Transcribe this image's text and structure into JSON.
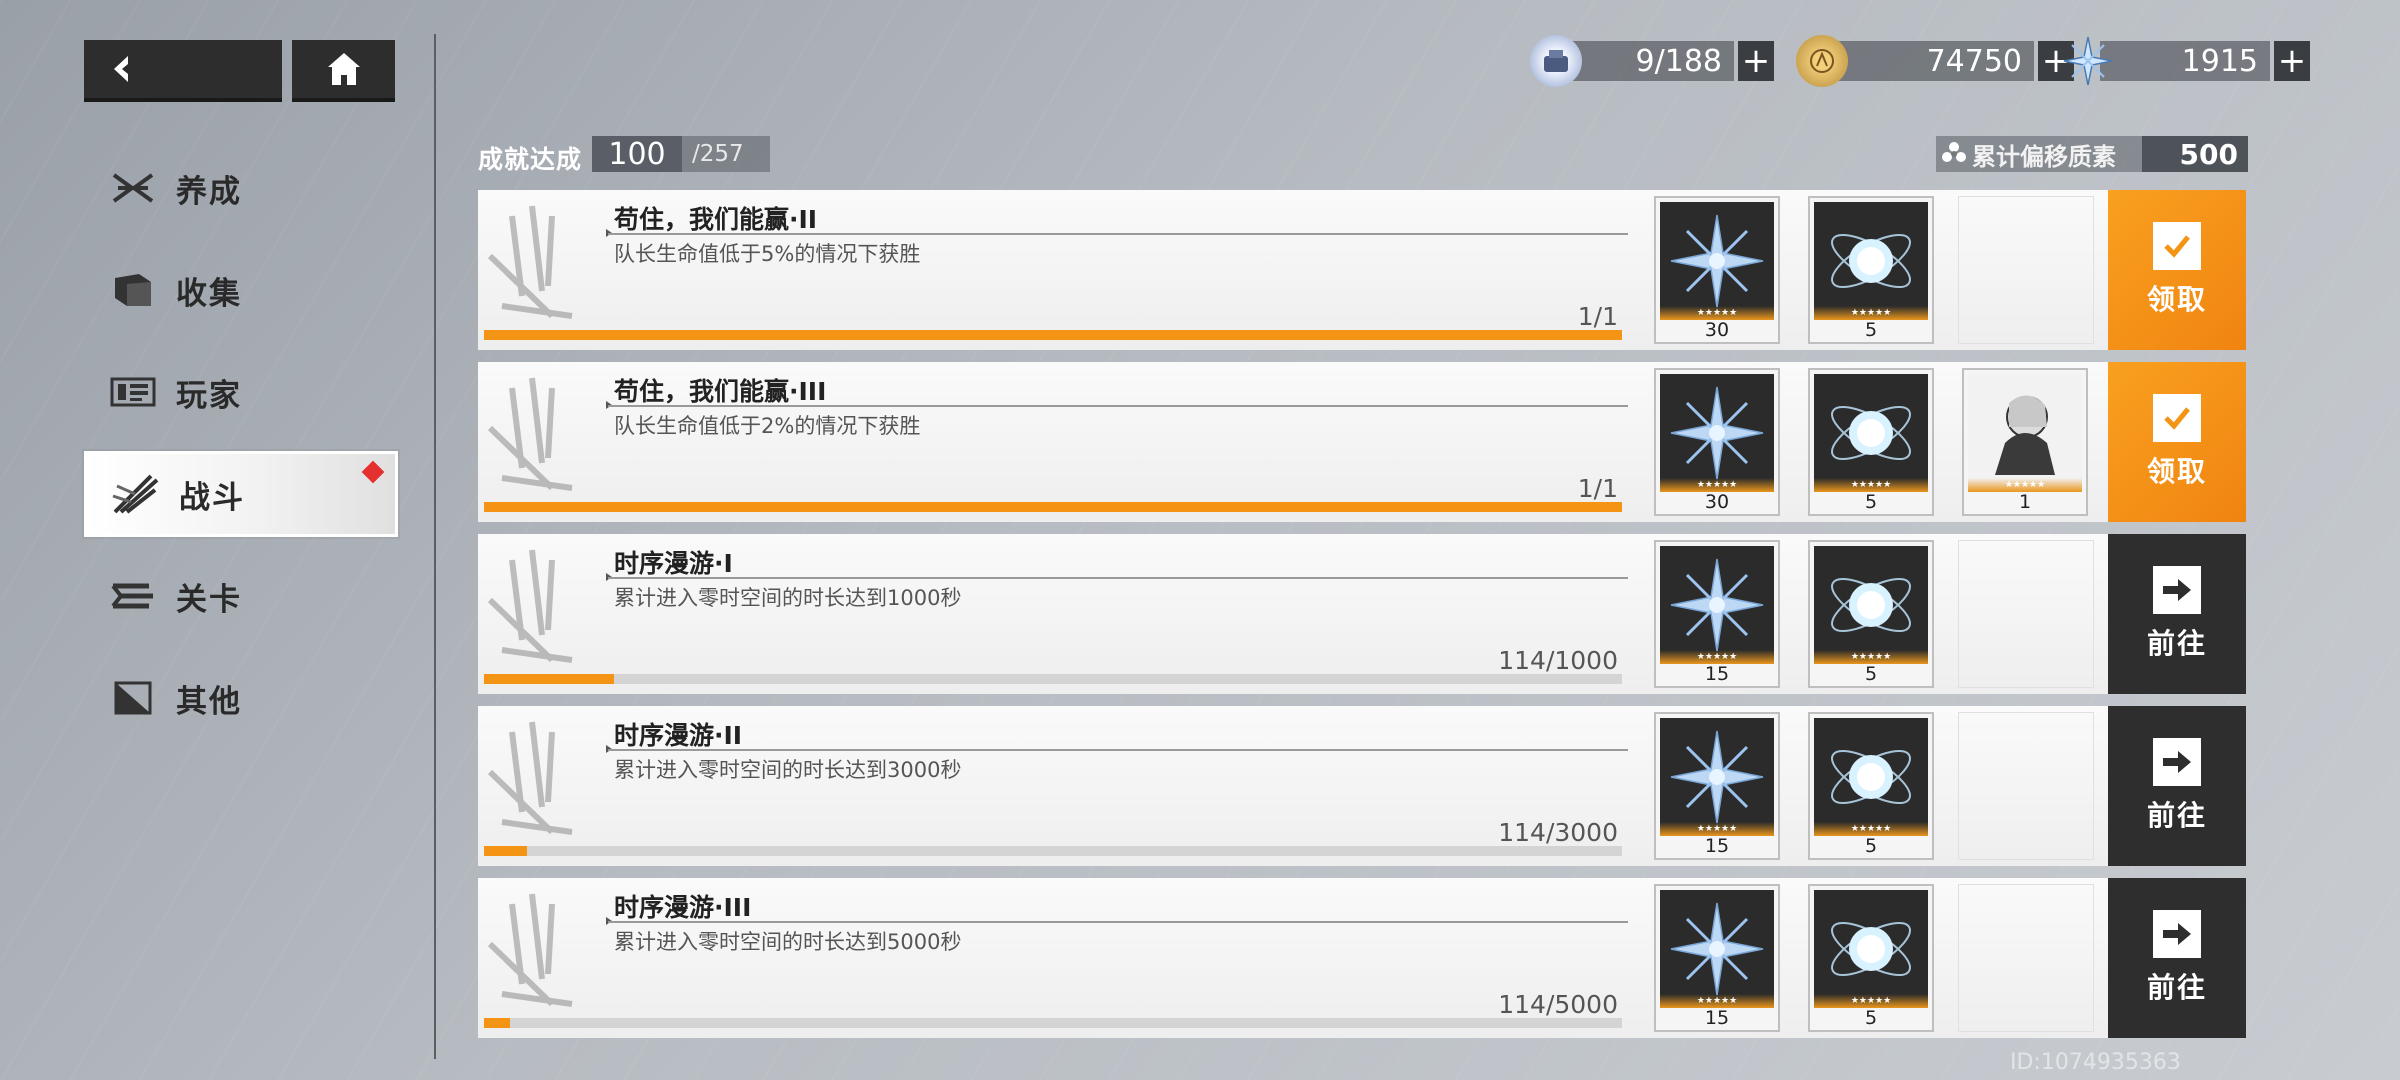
{
  "nav": {
    "back_icon": "back-arrow-icon",
    "home_icon": "home-icon"
  },
  "sidebar": {
    "items": [
      {
        "label": "养成",
        "icon": "develop-icon"
      },
      {
        "label": "收集",
        "icon": "collect-icon"
      },
      {
        "label": "玩家",
        "icon": "player-icon"
      },
      {
        "label": "战斗",
        "icon": "battle-icon",
        "active": true
      },
      {
        "label": "关卡",
        "icon": "stage-icon"
      },
      {
        "label": "其他",
        "icon": "other-icon"
      }
    ]
  },
  "currencies": [
    {
      "icon": "stamina-icon",
      "value": "9/188"
    },
    {
      "icon": "coin-icon",
      "value": "74750"
    },
    {
      "icon": "crystal-icon",
      "value": "1915"
    }
  ],
  "achievement": {
    "label": "成就达成",
    "count": "100",
    "total": "/257"
  },
  "accumulated": {
    "label": "累计偏移质素",
    "value": "500"
  },
  "rows": [
    {
      "title": "苟住，我们能赢·II",
      "desc": "队长生命值低于5%的情况下获胜",
      "progress_text": "1/1",
      "progress": 1.0,
      "rewards": [
        {
          "icon": "crystal-reward-icon",
          "qty": "30",
          "stars": "★★★★★"
        },
        {
          "icon": "orb-reward-icon",
          "qty": "5",
          "stars": "★★★★★"
        }
      ],
      "action": {
        "type": "claim",
        "label": "领取",
        "icon": "check-icon"
      }
    },
    {
      "title": "苟住，我们能赢·III",
      "desc": "队长生命值低于2%的情况下获胜",
      "progress_text": "1/1",
      "progress": 1.0,
      "rewards": [
        {
          "icon": "crystal-reward-icon",
          "qty": "30",
          "stars": "★★★★★"
        },
        {
          "icon": "orb-reward-icon",
          "qty": "5",
          "stars": "★★★★★"
        },
        {
          "icon": "character-reward-icon",
          "qty": "1",
          "stars": "★★★★★"
        }
      ],
      "action": {
        "type": "claim",
        "label": "领取",
        "icon": "check-icon"
      }
    },
    {
      "title": "时序漫游·I",
      "desc": "累计进入零时空间的时长达到1000秒",
      "progress_text": "114/1000",
      "progress": 0.114,
      "rewards": [
        {
          "icon": "crystal-reward-icon",
          "qty": "15",
          "stars": "★★★★★"
        },
        {
          "icon": "orb-reward-icon",
          "qty": "5",
          "stars": "★★★★★"
        }
      ],
      "action": {
        "type": "go",
        "label": "前往",
        "icon": "arrow-right-icon"
      }
    },
    {
      "title": "时序漫游·II",
      "desc": "累计进入零时空间的时长达到3000秒",
      "progress_text": "114/3000",
      "progress": 0.038,
      "rewards": [
        {
          "icon": "crystal-reward-icon",
          "qty": "15",
          "stars": "★★★★★"
        },
        {
          "icon": "orb-reward-icon",
          "qty": "5",
          "stars": "★★★★★"
        }
      ],
      "action": {
        "type": "go",
        "label": "前往",
        "icon": "arrow-right-icon"
      }
    },
    {
      "title": "时序漫游·III",
      "desc": "累计进入零时空间的时长达到5000秒",
      "progress_text": "114/5000",
      "progress": 0.0228,
      "rewards": [
        {
          "icon": "crystal-reward-icon",
          "qty": "15",
          "stars": "★★★★★"
        },
        {
          "icon": "orb-reward-icon",
          "qty": "5",
          "stars": "★★★★★"
        }
      ],
      "action": {
        "type": "go",
        "label": "前往",
        "icon": "arrow-right-icon"
      }
    }
  ],
  "uid": "ID:1074935363",
  "colors": {
    "accent": "#f39415",
    "dark": "#2e2e2e",
    "alert": "#e53030"
  }
}
